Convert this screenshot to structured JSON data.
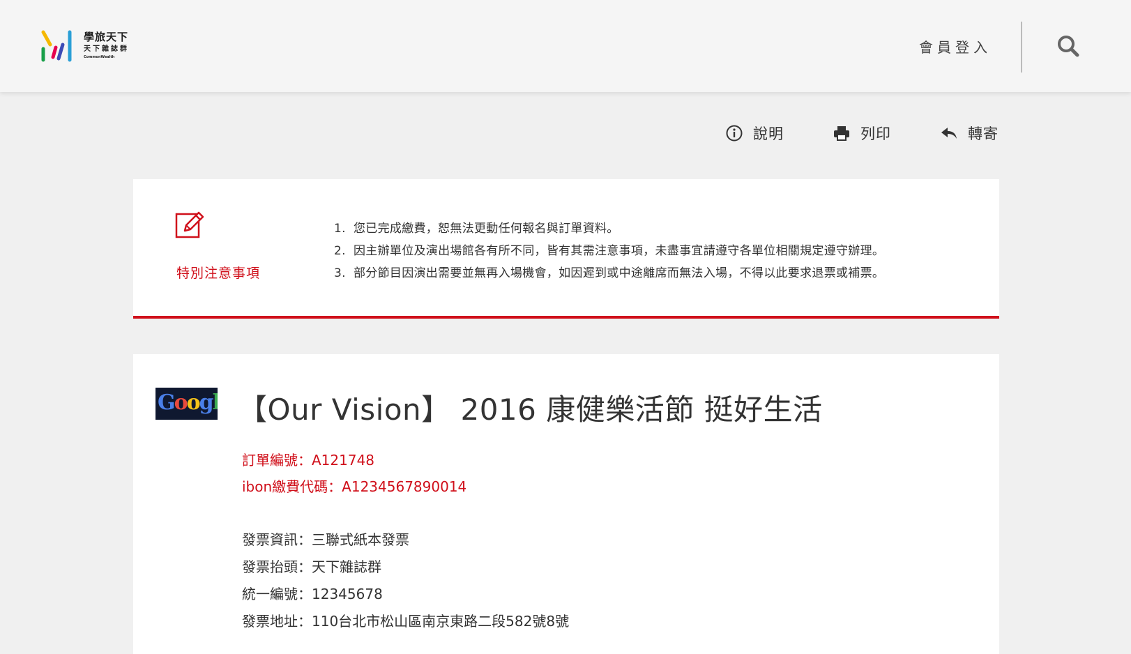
{
  "header": {
    "logo": {
      "name": "學旅天下",
      "subtitle": "天下雜誌群",
      "brand": "CommonWealth"
    },
    "login_label": "會員登入",
    "search_icon": "search-icon"
  },
  "toolbar": [
    {
      "label": "說明",
      "icon": "info-icon"
    },
    {
      "label": "列印",
      "icon": "printer-icon"
    },
    {
      "label": "轉寄",
      "icon": "reply-icon"
    }
  ],
  "notice": {
    "title": "特別注意事項",
    "icon": "edit-icon",
    "items": [
      {
        "num": "1.",
        "text": "您已完成繳費，恕無法更動任何報名與訂單資料。"
      },
      {
        "num": "2.",
        "text": "因主辦單位及演出場館各有所不同，皆有其需注意事項，未盡事宜請遵守各單位相關規定遵守辦理。"
      },
      {
        "num": "3.",
        "text": "部分節目因演出需要並無再入場機會，如因遲到或中途離席而無法入場，不得以此要求退票或補票。"
      }
    ]
  },
  "order": {
    "event_logo_text": "Google",
    "event_title": "【Our Vision】 2016 康健樂活節 挺好生活",
    "order_number": "訂單編號：A121748",
    "ibon_code": "ibon繳費代碼：A1234567890014",
    "invoice_info": "發票資訊：三聯式紙本發票",
    "invoice_title": "發票抬頭：天下雜誌群",
    "tax_id": "統一編號：12345678",
    "invoice_address": "發票地址：110台北市松山區南京東路二段582號8號"
  },
  "colors": {
    "accent_red": "#d0101b",
    "background": "#f0f0f0",
    "header_bg": "#f5f5f5"
  }
}
